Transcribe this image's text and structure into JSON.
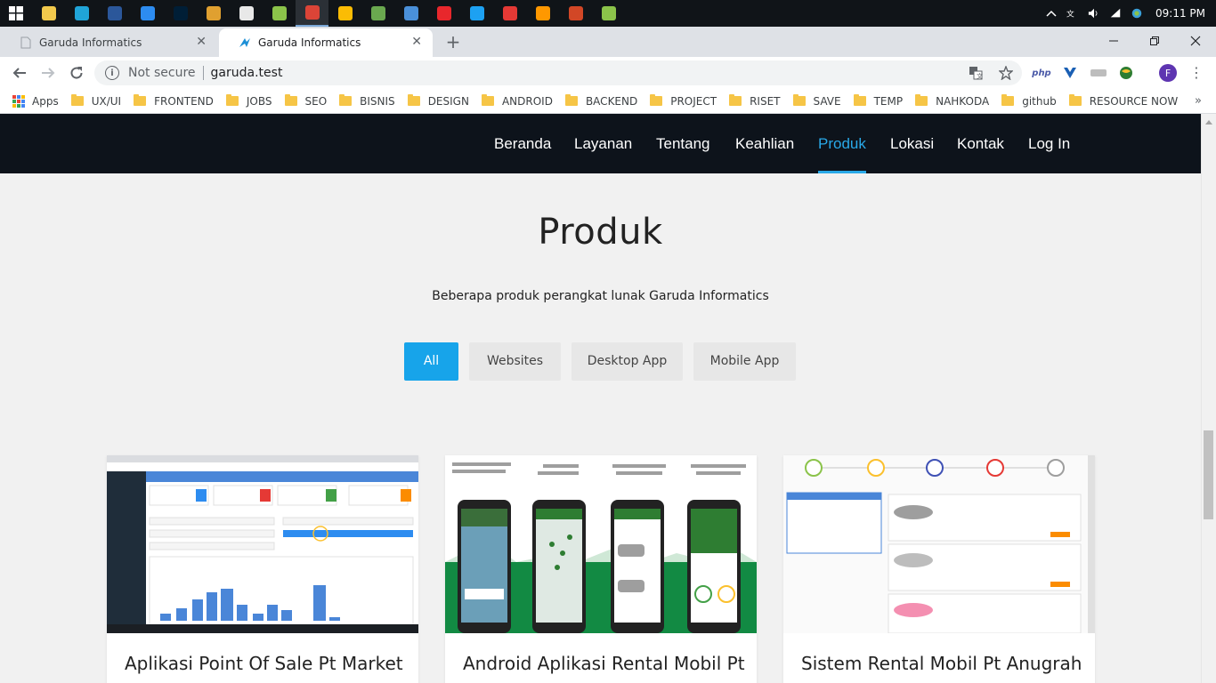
{
  "taskbar": {
    "apps": [
      {
        "icon": "file-explorer-icon",
        "color": "#f2c94c"
      },
      {
        "icon": "search-app-icon",
        "color": "#20a4d8"
      },
      {
        "icon": "word-icon",
        "color": "#2b579a"
      },
      {
        "icon": "app-blue-icon",
        "color": "#2d8cf0"
      },
      {
        "icon": "photoshop-icon",
        "color": "#001e36"
      },
      {
        "icon": "chrome-canary-icon",
        "color": "#e0a030"
      },
      {
        "icon": "obs-icon",
        "color": "#e8e8e8"
      },
      {
        "icon": "notepad-plus-icon",
        "color": "#8bc34a"
      },
      {
        "icon": "chrome-icon",
        "color": "#db4437"
      },
      {
        "icon": "keep-icon",
        "color": "#fbbc04"
      },
      {
        "icon": "lambda-icon",
        "color": "#6aa84f"
      },
      {
        "icon": "network-app-icon",
        "color": "#4a90d9"
      },
      {
        "icon": "opera-icon",
        "color": "#e8272c"
      },
      {
        "icon": "app-cyan-icon",
        "color": "#1da1f2"
      },
      {
        "icon": "app-red-icon",
        "color": "#e53935"
      },
      {
        "icon": "sublime-icon",
        "color": "#ff9800"
      },
      {
        "icon": "powerpoint-icon",
        "color": "#d24726"
      },
      {
        "icon": "app-green-badge-icon",
        "color": "#8bc34a"
      }
    ],
    "clock": "09:11 PM"
  },
  "browser": {
    "tabs": [
      {
        "title": "Garuda Informatics",
        "active": false
      },
      {
        "title": "Garuda Informatics",
        "active": true
      }
    ],
    "security_label": "Not secure",
    "url": "garuda.test",
    "profile_initial": "F",
    "extensions": [
      "php"
    ],
    "bookmarks": [
      "Apps",
      "UX/UI",
      "FRONTEND",
      "JOBS",
      "SEO",
      "BISNIS",
      "DESIGN",
      "ANDROID",
      "BACKEND",
      "PROJECT",
      "RISET",
      "SAVE",
      "TEMP",
      "NAHKODA",
      "github",
      "RESOURCE NOW"
    ]
  },
  "site": {
    "nav": [
      "Beranda",
      "Layanan",
      "Tentang",
      "Keahlian",
      "Produk",
      "Lokasi",
      "Kontak",
      "Log In"
    ],
    "active_nav": "Produk",
    "accent": "#29a9e8",
    "section": {
      "title": "Produk",
      "subtitle": "Beberapa produk perangkat lunak Garuda Informatics"
    },
    "filters": [
      "All",
      "Websites",
      "Desktop App",
      "Mobile App"
    ],
    "active_filter": "All",
    "products": [
      {
        "title": "Aplikasi Point Of Sale Pt Market"
      },
      {
        "title": "Android Aplikasi Rental Mobil Pt"
      },
      {
        "title": "Sistem Rental Mobil Pt Anugrah"
      }
    ]
  }
}
